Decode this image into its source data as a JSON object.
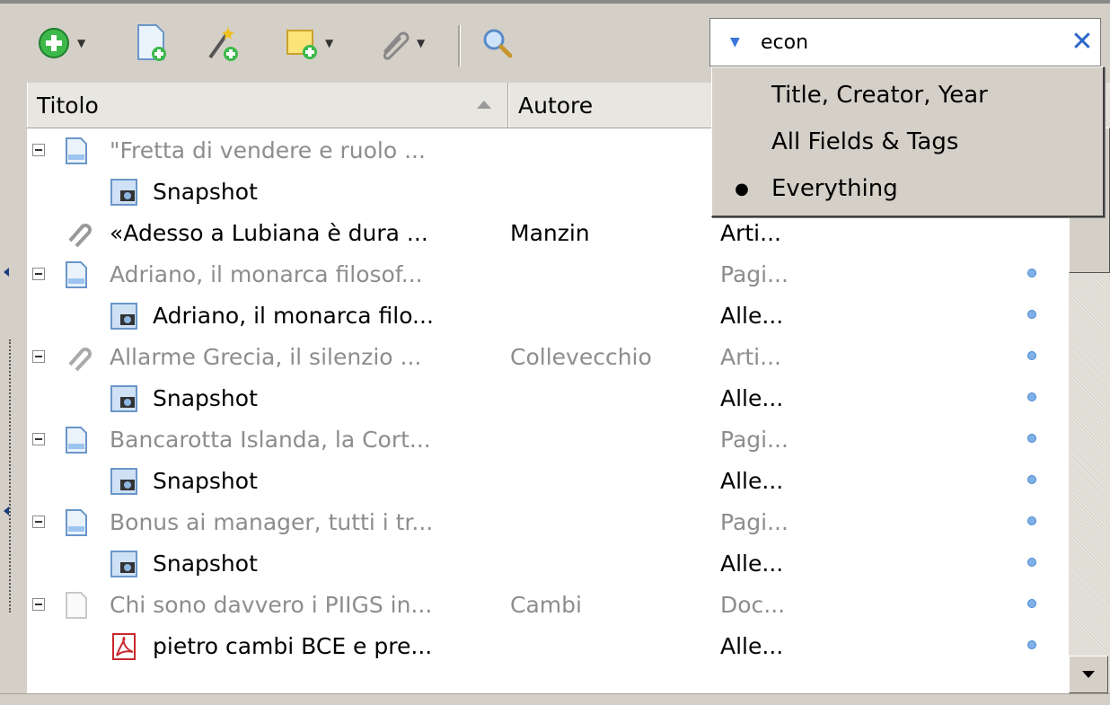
{
  "search": {
    "value": "econ",
    "menu": [
      {
        "label": "Title, Creator, Year",
        "selected": false
      },
      {
        "label": "All Fields & Tags",
        "selected": false
      },
      {
        "label": "Everything",
        "selected": true
      }
    ],
    "bullet": "●"
  },
  "columns": {
    "title": "Titolo",
    "author": "Autore"
  },
  "rows": [
    {
      "title": "\"Fretta di vendere e ruolo ...",
      "author": "",
      "type": ""
    },
    {
      "title": "Snapshot",
      "author": "",
      "type": ""
    },
    {
      "title": "«Adesso a Lubiana è dura ...",
      "author": "Manzin",
      "type": "Arti..."
    },
    {
      "title": "Adriano, il monarca filosof...",
      "author": "",
      "type": "Pagi..."
    },
    {
      "title": "Adriano, il monarca filo...",
      "author": "",
      "type": "Alle..."
    },
    {
      "title": "Allarme Grecia, il silenzio ...",
      "author": "Collevecchio",
      "type": "Arti..."
    },
    {
      "title": "Snapshot",
      "author": "",
      "type": "Alle..."
    },
    {
      "title": "Bancarotta Islanda, la Cort...",
      "author": "",
      "type": "Pagi..."
    },
    {
      "title": "Snapshot",
      "author": "",
      "type": "Alle..."
    },
    {
      "title": "Bonus ai manager, tutti i tr...",
      "author": "",
      "type": "Pagi..."
    },
    {
      "title": "Snapshot",
      "author": "",
      "type": "Alle..."
    },
    {
      "title": "Chi sono davvero i PIIGS in...",
      "author": "Cambi",
      "type": "Doc..."
    },
    {
      "title": "pietro cambi BCE e pre...",
      "author": "",
      "type": "Alle..."
    }
  ],
  "colors": {
    "accent": "#3a78d8",
    "unread_dot": "#7fb0e8",
    "parent_text": "#8d8d8d"
  }
}
